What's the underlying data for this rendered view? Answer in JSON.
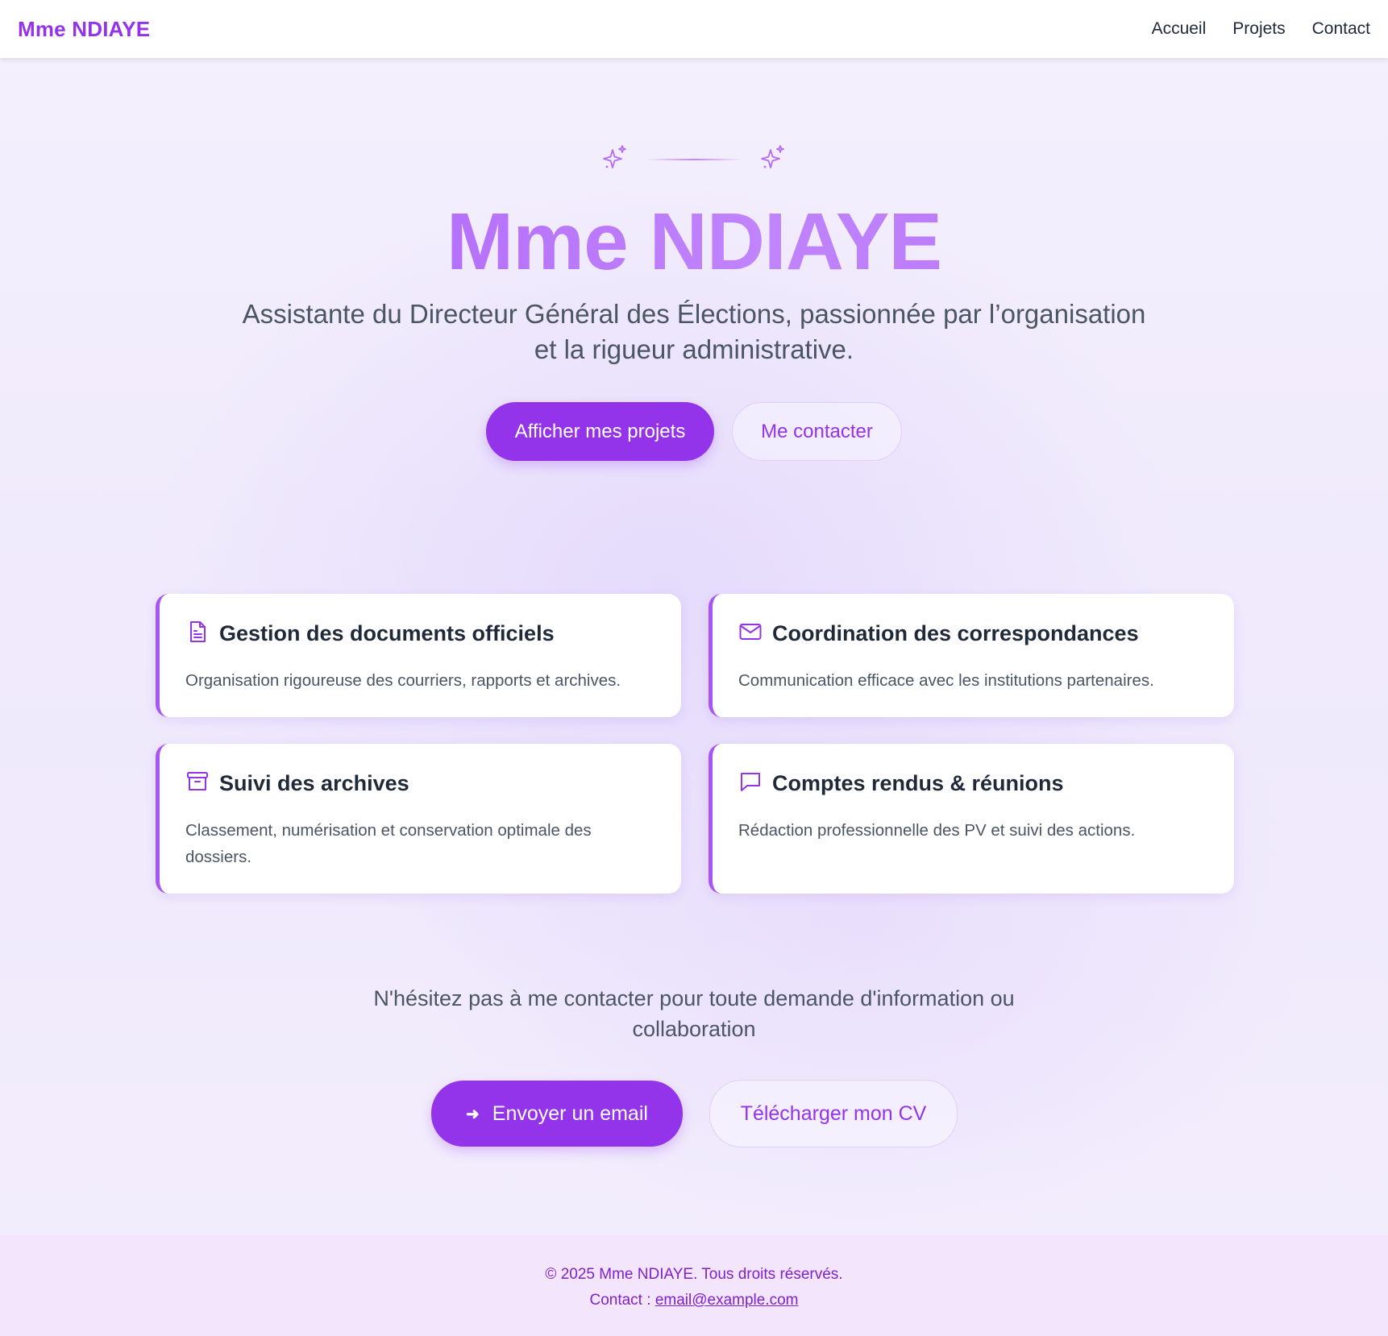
{
  "header": {
    "brand": "Mme NDIAYE",
    "nav": [
      "Accueil",
      "Projets",
      "Contact"
    ]
  },
  "hero": {
    "title": "Mme NDIAYE",
    "subtitle": "Assistante du Directeur Général des Élections, passionnée par l’organisation et la rigueur administrative.",
    "primary_button": "Afficher mes projets",
    "secondary_button": "Me contacter",
    "ornament_icons": [
      "sparkles-icon",
      "sparkles-icon"
    ]
  },
  "cards": [
    {
      "icon": "document-icon",
      "title": "Gestion des documents officiels",
      "text": "Organisation rigoureuse des courriers, rapports et archives."
    },
    {
      "icon": "mail-icon",
      "title": "Coordination des correspondances",
      "text": "Communication efficace avec les institutions partenaires."
    },
    {
      "icon": "archive-icon",
      "title": "Suivi des archives",
      "text": "Classement, numérisation et conservation optimale des dossiers."
    },
    {
      "icon": "chat-bubble-icon",
      "title": "Comptes rendus & réunions",
      "text": "Rédaction professionnelle des PV et suivi des actions."
    }
  ],
  "contact": {
    "text": "N'hésitez pas à me contacter pour toute demande d'information ou collaboration",
    "email_button": "Envoyer un email",
    "email_button_icon": "arrow-right-icon",
    "cv_button": "Télécharger mon CV"
  },
  "footer": {
    "copyright": "© 2025 Mme NDIAYE. Tous droits réservés.",
    "contact_label": "Contact : ",
    "contact_email": "email@example.com"
  },
  "colors": {
    "accent": "#9333ea",
    "accent_light": "#c084fc",
    "footer_bg": "#f3e5fb"
  }
}
